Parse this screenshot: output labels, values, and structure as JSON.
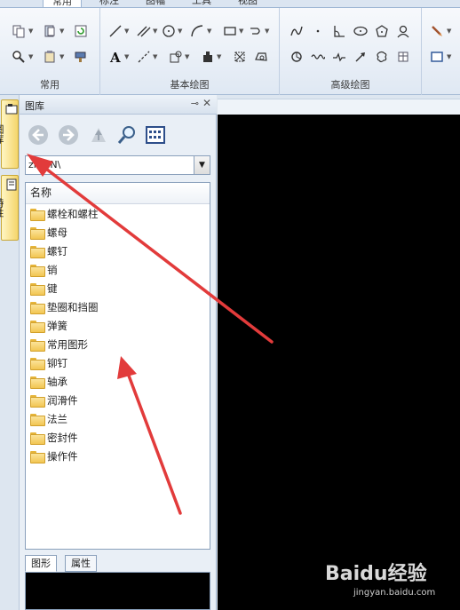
{
  "ribbon_tabs": [
    {
      "label": "常用",
      "active": true
    },
    {
      "label": "标注",
      "active": false
    },
    {
      "label": "图幅",
      "active": false
    },
    {
      "label": "工具",
      "active": false
    },
    {
      "label": "视图",
      "active": false
    }
  ],
  "ribbon_groups": {
    "common": "常用",
    "basic_draw": "基本绘图",
    "advanced_draw": "高级绘图"
  },
  "left_tabs": {
    "library": "图库",
    "properties": "特性"
  },
  "panel": {
    "title": "图库",
    "pin_icon": "pin-icon",
    "close_icon": "close-icon",
    "path_value": "zh-CN\\",
    "list_header": "名称",
    "items": [
      "螺栓和螺柱",
      "螺母",
      "螺钉",
      "销",
      "键",
      "垫圈和挡圈",
      "弹簧",
      "常用图形",
      "铆钉",
      "轴承",
      "润滑件",
      "法兰",
      "密封件",
      "操作件"
    ],
    "subtabs": [
      "图形",
      "属性"
    ]
  },
  "watermark": {
    "brand": "Baidu经验",
    "sub": "jingyan.baidu.com"
  },
  "colors": {
    "arrow": "#e23b3b",
    "canvas": "#000000",
    "folder": "#f2c552",
    "accent_tab": "#f5d56b"
  }
}
